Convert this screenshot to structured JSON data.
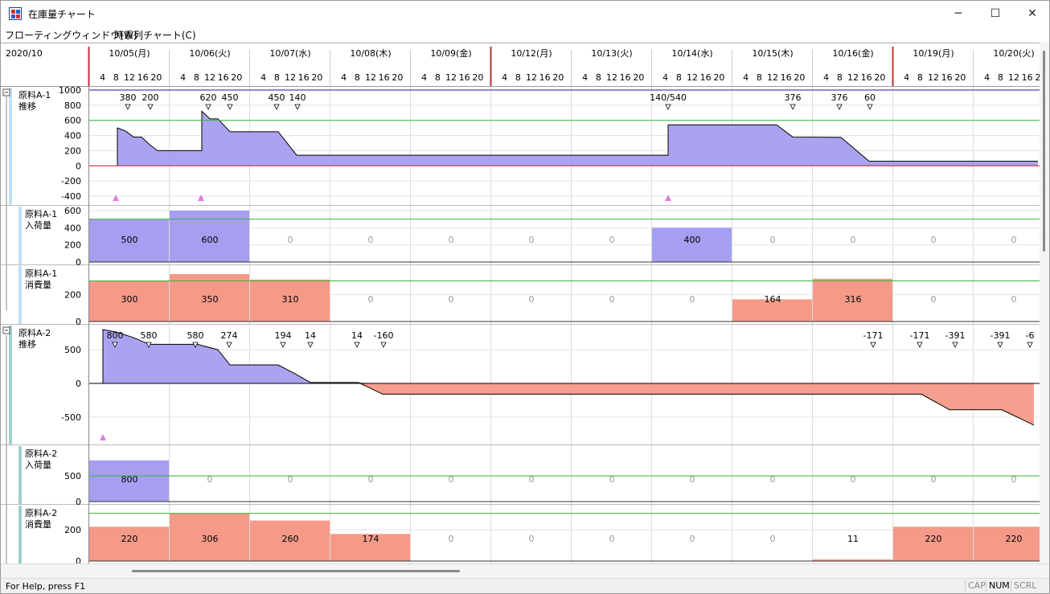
{
  "window": {
    "title": "在庫量チャート",
    "minimize_glyph": "─",
    "maximize_glyph": "☐",
    "close_glyph": "✕"
  },
  "menu": [
    {
      "label": "フローティングウィンドウ(W)"
    },
    {
      "label": "時系列チャート(C)"
    }
  ],
  "header": {
    "year_month": "2020/10",
    "dates": [
      "10/05(月)",
      "10/06(火)",
      "10/07(水)",
      "10/08(木)",
      "10/09(金)",
      "10/12(月)",
      "10/13(火)",
      "10/14(水)",
      "10/15(木)",
      "10/16(金)",
      "10/19(月)",
      "10/20(火)"
    ],
    "hours": [
      "4",
      "8",
      "12",
      "16",
      "20"
    ],
    "week_start_indices": [
      0,
      5,
      10
    ]
  },
  "colors": {
    "accent_week": "#c0303a",
    "inventory_fill": "#a69ef0",
    "negative_fill": "#f59a88",
    "receipt_fill": "#a69ef0",
    "consumption_fill": "#f59a88",
    "level_max": "#1a1a9a",
    "level_safety": "#38b238",
    "zero_line": "#cc2020",
    "marker": "#e27be3",
    "group1_band": "#bfe0f6",
    "group2_band": "#9ed1cc"
  },
  "chart_data": [
    {
      "type": "area",
      "group": 1,
      "name_line1": "原料A-1",
      "name_line2": "推移",
      "yticks": [
        "1000",
        "800",
        "600",
        "400",
        "200",
        "0",
        "-200",
        "-400"
      ],
      "ylim": [
        -400,
        1000
      ],
      "max_level": 1000,
      "safety_level": 600,
      "points_day_hour": [
        [
          0.35,
          0
        ],
        [
          0.35,
          500
        ],
        [
          0.45,
          460
        ],
        [
          0.55,
          380
        ],
        [
          0.65,
          380
        ],
        [
          0.75,
          280
        ],
        [
          0.85,
          200
        ],
        [
          1.4,
          200
        ],
        [
          1.4,
          720
        ],
        [
          1.5,
          620
        ],
        [
          1.6,
          620
        ],
        [
          1.75,
          450
        ],
        [
          2.35,
          450
        ],
        [
          2.58,
          140
        ],
        [
          7.2,
          140
        ],
        [
          7.2,
          540
        ],
        [
          8.55,
          540
        ],
        [
          8.75,
          380
        ],
        [
          9.35,
          376
        ],
        [
          9.7,
          60
        ],
        [
          11.8,
          60
        ]
      ],
      "callouts": [
        {
          "x": 0.48,
          "label": "380"
        },
        {
          "x": 0.76,
          "label": "200"
        },
        {
          "x": 1.48,
          "label": "620"
        },
        {
          "x": 1.75,
          "label": "450"
        },
        {
          "x": 2.33,
          "label": "450"
        },
        {
          "x": 2.59,
          "label": "140"
        },
        {
          "x": 7.2,
          "label": "140/540"
        },
        {
          "x": 8.75,
          "label": "376"
        },
        {
          "x": 9.33,
          "label": "376"
        },
        {
          "x": 9.71,
          "label": "60"
        }
      ],
      "markers_day": [
        0.33,
        1.39,
        7.2
      ]
    },
    {
      "type": "bar",
      "group": 1,
      "name_line1": "原料A-1",
      "name_line2": "入荷量",
      "yticks": [
        "600",
        "400",
        "200",
        "0"
      ],
      "ylim": [
        0,
        600
      ],
      "safety_level": 500,
      "values": [
        500,
        600,
        0,
        0,
        0,
        0,
        0,
        400,
        0,
        0,
        0,
        0
      ],
      "labels": [
        "500",
        "600",
        "0",
        "0",
        "0",
        "0",
        "0",
        "400",
        "0",
        "0",
        "0",
        "0"
      ],
      "series_kind": "receipt"
    },
    {
      "type": "bar",
      "group": 1,
      "name_line1": "原料A-1",
      "name_line2": "消費量",
      "yticks": [
        "200",
        "0"
      ],
      "ylim": [
        0,
        380
      ],
      "safety_level": 300,
      "values": [
        300,
        350,
        310,
        0,
        0,
        0,
        0,
        0,
        164,
        316,
        0,
        0
      ],
      "labels": [
        "300",
        "350",
        "310",
        "0",
        "0",
        "0",
        "0",
        "0",
        "164",
        "316",
        "0",
        "0"
      ],
      "series_kind": "consumption"
    },
    {
      "type": "area",
      "group": 2,
      "name_line1": "原料A-2",
      "name_line2": "推移",
      "yticks": [
        "500",
        "0",
        "-500"
      ],
      "ylim": [
        -800,
        800
      ],
      "max_level": null,
      "safety_level": null,
      "points_day_hour": [
        [
          0.17,
          0
        ],
        [
          0.17,
          800
        ],
        [
          0.35,
          760
        ],
        [
          0.55,
          680
        ],
        [
          0.75,
          580
        ],
        [
          1.35,
          580
        ],
        [
          1.6,
          500
        ],
        [
          1.75,
          274
        ],
        [
          2.35,
          274
        ],
        [
          2.55,
          150
        ],
        [
          2.75,
          14
        ],
        [
          3.35,
          14
        ],
        [
          3.65,
          -160
        ],
        [
          10.35,
          -160
        ],
        [
          10.7,
          -391
        ],
        [
          11.35,
          -391
        ],
        [
          11.75,
          -620
        ]
      ],
      "callouts": [
        {
          "x": 0.32,
          "label": "800"
        },
        {
          "x": 0.74,
          "label": "580"
        },
        {
          "x": 1.32,
          "label": "580"
        },
        {
          "x": 1.74,
          "label": "274"
        },
        {
          "x": 2.41,
          "label": "194"
        },
        {
          "x": 2.75,
          "label": "14"
        },
        {
          "x": 3.33,
          "label": "14"
        },
        {
          "x": 3.66,
          "label": "-160"
        },
        {
          "x": 9.75,
          "label": "-171"
        },
        {
          "x": 10.33,
          "label": "-171"
        },
        {
          "x": 10.77,
          "label": "-391"
        },
        {
          "x": 11.33,
          "label": "-391"
        },
        {
          "x": 11.7,
          "label": "-6"
        }
      ],
      "markers_day": [
        0.17
      ]
    },
    {
      "type": "bar",
      "group": 2,
      "name_line1": "原料A-2",
      "name_line2": "入荷量",
      "yticks": [
        "500",
        "0"
      ],
      "ylim": [
        0,
        1000
      ],
      "safety_level": 500,
      "values": [
        800,
        0,
        0,
        0,
        0,
        0,
        0,
        0,
        0,
        0,
        0,
        0
      ],
      "labels": [
        "800",
        "0",
        "0",
        "0",
        "0",
        "0",
        "0",
        "0",
        "0",
        "0",
        "0",
        "0"
      ],
      "series_kind": "receipt"
    },
    {
      "type": "bar",
      "group": 2,
      "name_line1": "原料A-2",
      "name_line2": "消費量",
      "yticks": [
        "200",
        "0"
      ],
      "ylim": [
        0,
        330
      ],
      "safety_level": 306,
      "values": [
        220,
        306,
        260,
        174,
        0,
        0,
        0,
        0,
        0,
        11,
        220,
        220
      ],
      "labels": [
        "220",
        "306",
        "260",
        "174",
        "0",
        "0",
        "0",
        "0",
        "0",
        "11",
        "220",
        "220"
      ],
      "series_kind": "consumption"
    }
  ],
  "statusbar": {
    "help": "For Help, press F1",
    "indicators": [
      "CAP",
      "NUM",
      "SCRL"
    ],
    "active_indicator": "NUM"
  }
}
